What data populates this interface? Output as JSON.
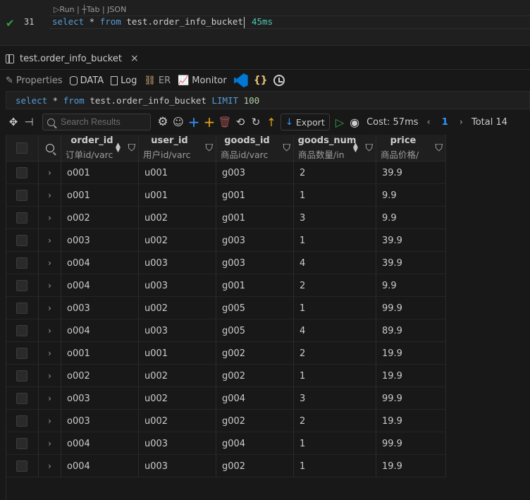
{
  "editor": {
    "codelens": "▷Run | ┼Tab | JSON",
    "line_number": "31",
    "code_kw1": "select",
    "code_mid": " * ",
    "code_kw2": "from",
    "code_rest": " test.order_info_bucket",
    "timing": "45ms"
  },
  "result_tab": {
    "label": "test.order_info_bucket",
    "close": "×"
  },
  "subtabs": {
    "properties": "Properties",
    "data": "DATA",
    "log": "Log",
    "er": "ER",
    "monitor": "Monitor",
    "braces": "{}"
  },
  "sql": {
    "kw1": "select",
    "mid": " * ",
    "kw2": "from",
    "table": " test.order_info_bucket ",
    "kw3": "LIMIT",
    "limit": " 100"
  },
  "toolbar": {
    "search_placeholder": "Search Results",
    "export_label": "Export",
    "cost": "Cost: 57ms",
    "page": "1",
    "total": "Total 14"
  },
  "columns": [
    {
      "name": "order_id",
      "type": "订单id/varc"
    },
    {
      "name": "user_id",
      "type": "用户id/varc"
    },
    {
      "name": "goods_id",
      "type": "商品id/varc"
    },
    {
      "name": "goods_num",
      "type": "商品数量/in"
    },
    {
      "name": "price",
      "type": "商品价格/"
    }
  ],
  "rows": [
    [
      "o001",
      "u001",
      "g003",
      "2",
      "39.9"
    ],
    [
      "o001",
      "u001",
      "g001",
      "1",
      "9.9"
    ],
    [
      "o002",
      "u002",
      "g001",
      "3",
      "9.9"
    ],
    [
      "o003",
      "u002",
      "g003",
      "1",
      "39.9"
    ],
    [
      "o004",
      "u003",
      "g003",
      "4",
      "39.9"
    ],
    [
      "o004",
      "u003",
      "g001",
      "2",
      "9.9"
    ],
    [
      "o003",
      "u002",
      "g005",
      "1",
      "99.9"
    ],
    [
      "o004",
      "u003",
      "g005",
      "4",
      "89.9"
    ],
    [
      "o001",
      "u001",
      "g002",
      "2",
      "19.9"
    ],
    [
      "o002",
      "u002",
      "g002",
      "1",
      "19.9"
    ],
    [
      "o003",
      "u002",
      "g004",
      "3",
      "99.9"
    ],
    [
      "o003",
      "u002",
      "g002",
      "2",
      "19.9"
    ],
    [
      "o004",
      "u003",
      "g004",
      "1",
      "99.9"
    ],
    [
      "o004",
      "u003",
      "g002",
      "1",
      "19.9"
    ]
  ]
}
